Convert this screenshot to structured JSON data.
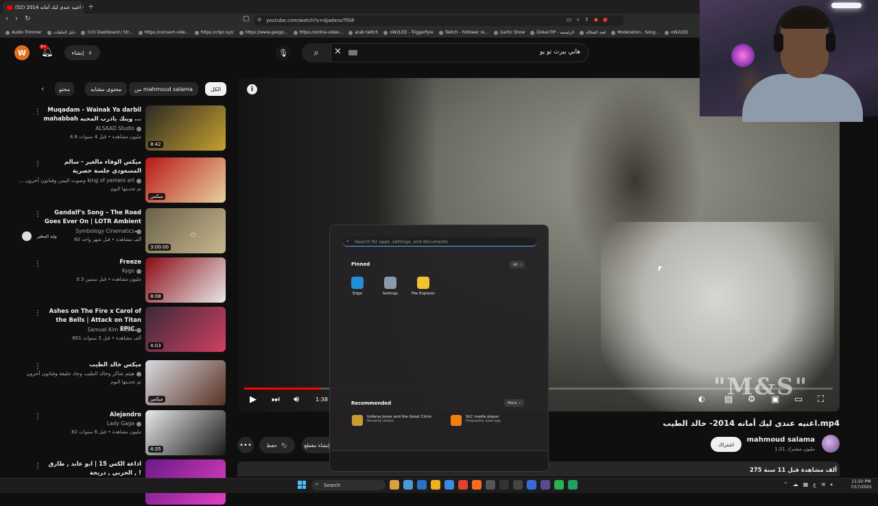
{
  "browser": {
    "tab_title": "(52) اغنيه عندى ليك أمانه 2014 - ...",
    "url": "youtube.com/watch?v=AJadxnuTfG8",
    "bookmarks": [
      "Audio Trimmer",
      "دليل الحلقات",
      "(10) Dashboard / Str...",
      "https://convert-vide...",
      "https://clipr.xyz/",
      "https://www.geogo...",
      "https://online-video...",
      "arab twitch",
      "oW2LED - Triggerfyre",
      "Twitch - Follower re...",
      "Gartic Show",
      "DokanTIP - الرئيسية",
      "لعبة الشلالة",
      "Moderation - Song...",
      "oW2LED"
    ]
  },
  "header": {
    "avatar_letter": "W",
    "notif_badge": "9+",
    "create_label": "إنشاء",
    "search_query": "هابي بيرث تو يو"
  },
  "chips": [
    "الكل",
    "من mahmoud salama",
    "محتوى مشابه",
    "محتو"
  ],
  "playlist": [
    {
      "title": "Muqadam - Wainak Ya darbil mahabbah وينك ياذرب المحبه ...",
      "channel": "ALSAAD Studio",
      "meta": "4.6 مليون مشاهدة • قبل 4 سنوات",
      "duration": "8:42",
      "colors": [
        "#2a2a24",
        "#c8a030"
      ]
    },
    {
      "title": "ميكس الوفاء مالغير - سالم المسعودي جلسة حصرية",
      "channel": "... وصوت اليمن وفنانون آخرون king of yemeni art",
      "meta": "تم تحديثها اليوم",
      "duration": "ميكس",
      "colors": [
        "#b81818",
        "#e8d0a0"
      ]
    },
    {
      "title": "Gandalf's Song – The Road Goes Ever On | LOTR Ambient ...",
      "channel": "Symbology Cinematics",
      "meta": "60 ألف مشاهدة • قبل شهر واحد",
      "duration": "3:00:00",
      "colors": [
        "#6a6048",
        "#c8b890"
      ]
    },
    {
      "title": "Freeze",
      "channel": "Kygo",
      "meta": "9.3 مليون مشاهدة • قبل سنتين",
      "duration": "8:08",
      "colors": [
        "#8a0a14",
        "#e8e8e8"
      ]
    },
    {
      "title": "Ashes on The Fire x Carol of the Bells | Attack on Titan EPIC...",
      "channel": "Samuel Kim Music",
      "meta": "861 ألف مشاهدة • قبل 3 سنوات",
      "duration": "4:03",
      "colors": [
        "#3a2a3a",
        "#d04060"
      ]
    },
    {
      "title": "ميكس خالد الطيب",
      "channel": "هيثم شاكر وخالد الطيب وجاد خليفة وفنانون آخرون",
      "meta": "تم تحديثها اليوم",
      "duration": "ميكس",
      "colors": [
        "#d8dce4",
        "#5a3020"
      ]
    },
    {
      "title": "Alejandro",
      "channel": "Lady Gaga",
      "meta": "82 مليون مشاهدة • قبل 6 سنوات",
      "duration": "4:35",
      "colors": [
        "#e8e8e8",
        "#1a1a1a"
      ]
    },
    {
      "title": "اذاعة الكس 15 | ابو عابد , طارق الحربي , دريحة , !",
      "channel": "",
      "meta": "",
      "duration": "",
      "colors": [
        "#6a1a8a",
        "#e040c0"
      ]
    }
  ],
  "player": {
    "current_time": "1:38",
    "progress_fraction": 0.13,
    "watermark": "\"M&S\""
  },
  "video": {
    "title": "اغنيه عندى ليك أمانه 2014- خالد الطيب.mp4",
    "channel": "mahmoud salama",
    "subs": "1.01 مليون مشترك",
    "subscribe_label": "اشتراك",
    "save_label": "حفظ",
    "clip_label": "إنشاء مقطع",
    "views_meta": "275 ألف مشاهدة  قبل 11 سنة"
  },
  "startmenu": {
    "search_placeholder": "Search for apps, settings, and documents",
    "pinned_label": "Pinned",
    "all_label": "All",
    "pinned_apps": [
      {
        "name": "Edge",
        "color": "#1f8fd8"
      },
      {
        "name": "Settings",
        "color": "#8a9aaa"
      },
      {
        "name": "File Explorer",
        "color": "#f2c230"
      }
    ],
    "recommended_label": "Recommended",
    "more_label": "More",
    "recommended": [
      {
        "name": "Indiana Jones and the Great Circle",
        "sub": "Recently added",
        "color": "#c89a30"
      },
      {
        "name": "VLC media player",
        "sub": "Frequently used app",
        "color": "#f08010"
      }
    ],
    "user_name": "وليد المطير"
  },
  "taskbar": {
    "search_label": "Search",
    "time": "11:50 PM",
    "date": "7/17/2025",
    "icon_colors": [
      "#d8a040",
      "#4a9ad8",
      "#2a70c8",
      "#f0b020",
      "#3a8ae0",
      "#e04030",
      "#ff6a20",
      "#555555",
      "#333333",
      "#444444",
      "#3a6ad8",
      "#5a4a8a",
      "#2ab050",
      "#20a060"
    ]
  }
}
